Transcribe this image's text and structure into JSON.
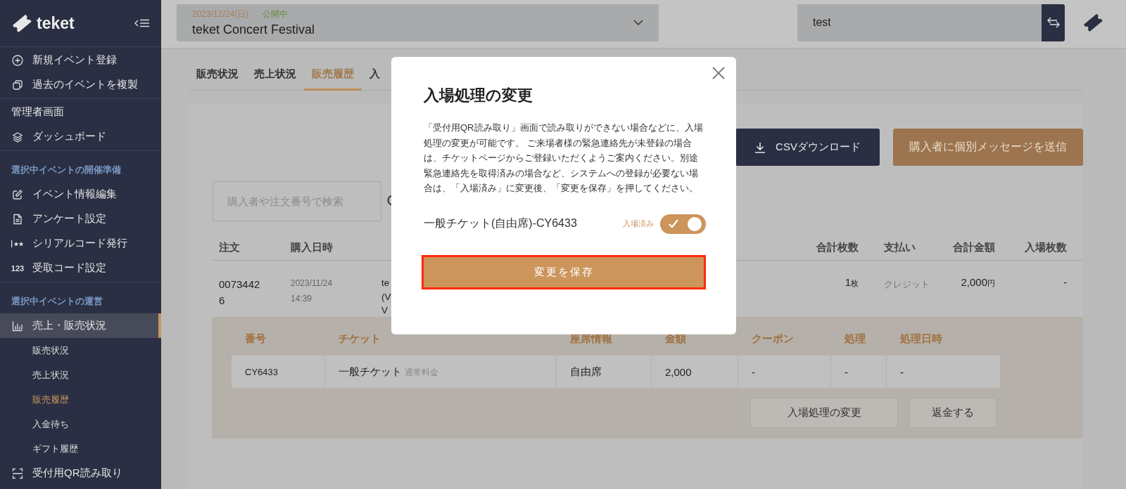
{
  "sidebar": {
    "logo": "teket",
    "groups": [
      {
        "items": [
          {
            "kind": "link",
            "label": "新規イベント登録",
            "selected": false
          },
          {
            "kind": "link",
            "label": "過去のイベントを複製",
            "selected": false
          }
        ]
      },
      {
        "items": [
          {
            "kind": "heading",
            "label": "管理者画面"
          },
          {
            "kind": "link",
            "label": "ダッシュボード",
            "selected": false
          }
        ]
      },
      {
        "items": [
          {
            "kind": "section",
            "label": "選択中イベントの開催準備"
          },
          {
            "kind": "link",
            "label": "イベント情報編集",
            "selected": false
          },
          {
            "kind": "link",
            "label": "アンケート設定",
            "selected": false
          },
          {
            "kind": "link",
            "label": "シリアルコード発行",
            "selected": false
          },
          {
            "kind": "link",
            "label": "受取コード設定",
            "icon_text": "123",
            "selected": false
          }
        ]
      },
      {
        "items": [
          {
            "kind": "section",
            "label": "選択中イベントの運営"
          },
          {
            "kind": "link",
            "label": "売上・販売状況",
            "selected": true,
            "children": [
              {
                "label": "販売状況",
                "selected": false
              },
              {
                "label": "売上状況",
                "selected": false
              },
              {
                "label": "販売履歴",
                "selected": true
              },
              {
                "label": "入金待ち",
                "selected": false
              },
              {
                "label": "ギフト履歴",
                "selected": false
              }
            ]
          },
          {
            "kind": "link",
            "label": "受付用QR読み取り",
            "selected": false
          }
        ]
      }
    ]
  },
  "topbar": {
    "event": {
      "date": "2023/12/24(日)",
      "status": "公開中",
      "name": "teket Concert Festival"
    },
    "organizer_field": {
      "value": "test"
    }
  },
  "tabs": [
    {
      "label": "販売状況",
      "selected": false
    },
    {
      "label": "売上状況",
      "selected": false
    },
    {
      "label": "販売履歴",
      "selected": true
    },
    {
      "label": "入",
      "selected": false
    }
  ],
  "actions": {
    "csv": "CSVダウンロード",
    "message": "購入者に個別メッセージを送信"
  },
  "search": {
    "placeholder": "購入者や注文番号で検索"
  },
  "orders": {
    "columns": [
      "注文",
      "購入日時",
      "合計枚数",
      "支払い",
      "合計金額",
      "入場枚数"
    ],
    "rows": [
      {
        "order": "00734426",
        "date": "2023/11/24 14:39",
        "buyer_lines": [
          "te",
          "(V",
          "V"
        ],
        "count": "1",
        "count_unit": "枚",
        "payment": "クレジット",
        "amount": "2,000",
        "amount_unit": "円",
        "entered": "-"
      }
    ]
  },
  "detail": {
    "columns": [
      "番号",
      "チケット",
      "座席情報",
      "金額",
      "クーポン",
      "処理",
      "処理日時"
    ],
    "rows": [
      {
        "number": "CY6433",
        "ticket": "一般チケット",
        "ticket_note": "通常料金",
        "seat": "自由席",
        "price": "2,000",
        "coupon": "-",
        "process": "-",
        "processed_at": "-"
      }
    ],
    "buttons": [
      "入場処理の変更",
      "返金する"
    ]
  },
  "modal": {
    "title": "入場処理の変更",
    "body": "「受付用QR読み取り」画面で読み取りができない場合などに、入場処理の変更が可能です。 ご来場者様の緊急連絡先が未登録の場合は、チケットページからご登録いただくようご案内ください。別途緊急連絡先を取得済みの場合など、システムへの登録が必要ない場合は、「入場済み」に変更後、「変更を保存」を押してください。",
    "ticket": "一般チケット(自由席)-CY6433",
    "toggle": {
      "label": "入場済み",
      "on": true
    },
    "save": "変更を保存"
  }
}
